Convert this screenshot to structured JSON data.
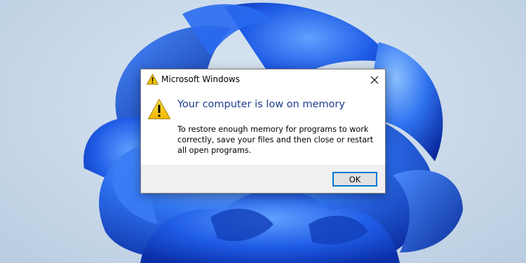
{
  "dialog": {
    "title": "Microsoft Windows",
    "main_instruction": "Your computer is low on memory",
    "body": "To restore enough memory for programs to work correctly, save your files and then close or restart all open programs.",
    "ok_label": "OK",
    "title_icon": "warning-icon",
    "content_icon": "warning-icon",
    "close_icon": "close-icon"
  },
  "colors": {
    "main_instruction": "#1c3c8c",
    "ok_border": "#0078d7",
    "footer_bg": "#f0f0f0",
    "warning_fill": "#f2c200",
    "wallpaper_blue": "#1f5ce6"
  }
}
